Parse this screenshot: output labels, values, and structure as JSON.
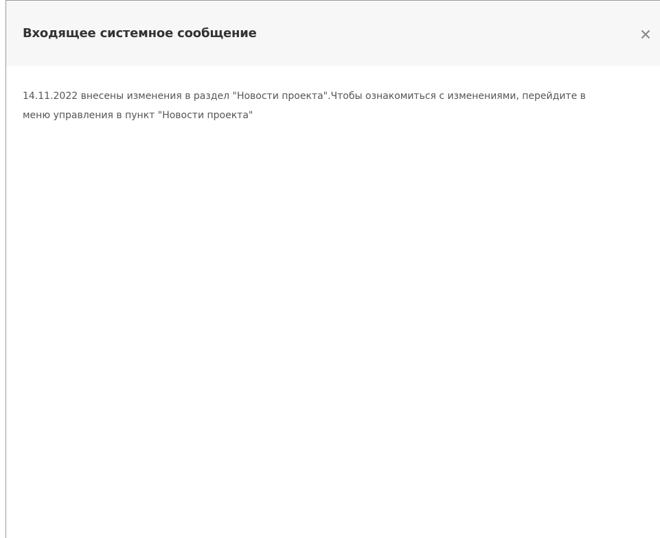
{
  "dialog": {
    "title": "Входящее системное сообщение",
    "close_icon": "close-icon",
    "message": "14.11.2022 внесены изменения в раздел \"Новости проекта\".Чтобы ознакомиться с изменениями, перейдите в меню управления в пункт \"Новости проекта\""
  },
  "colors": {
    "header_background": "#f7f7f7",
    "title_text": "#333333",
    "body_text": "#555555",
    "close_icon": "#8a8a8a",
    "border": "#9a9a9a"
  }
}
